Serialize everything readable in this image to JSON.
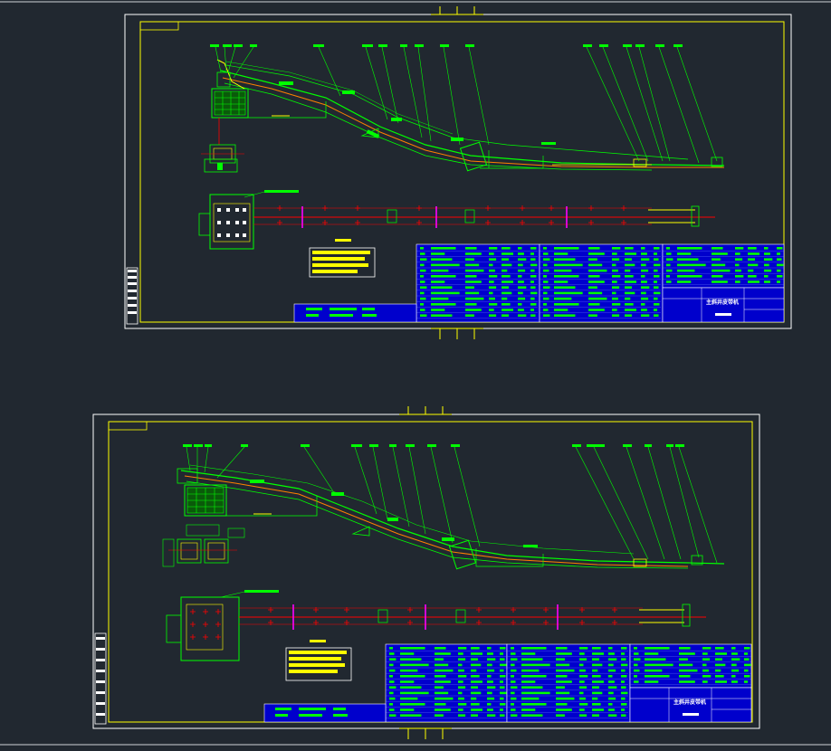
{
  "app": {
    "view": "model-space",
    "background": "#212830"
  },
  "colors": {
    "frame": "#ffffff",
    "border": "#ffff00",
    "geometry": "#00ff00",
    "centerline": "#ff0000",
    "accent": "#ff00ff",
    "table": "#0000ff",
    "belt": "#ff8000"
  },
  "sheets": [
    {
      "name": "drawing-sheet-1",
      "title_block_text": "主斜井皮带机"
    },
    {
      "name": "drawing-sheet-2",
      "title_block_text": "主斜井皮带机"
    }
  ]
}
